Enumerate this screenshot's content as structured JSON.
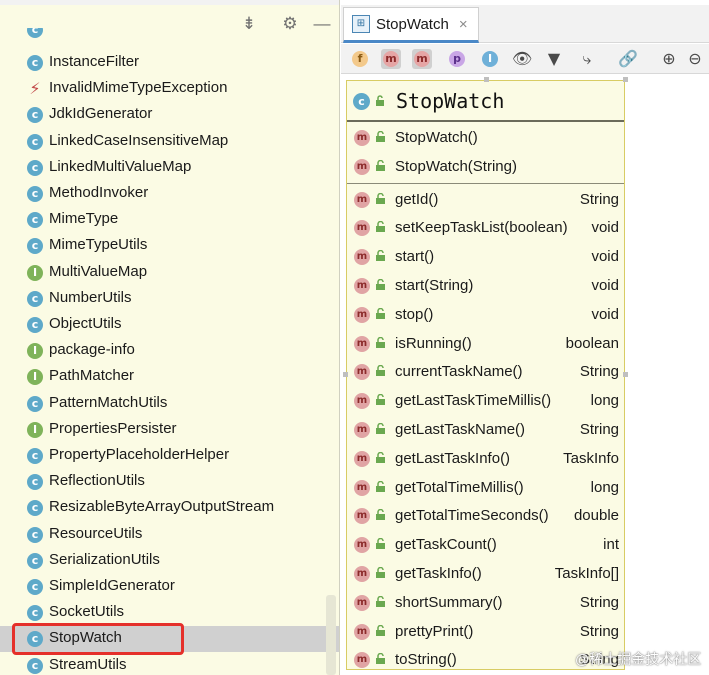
{
  "left_panel": {
    "toolbar": [
      {
        "name": "collapse-icon",
        "glyph": "⇟"
      },
      {
        "name": "gear-icon",
        "glyph": "⚙"
      },
      {
        "name": "minimize-icon",
        "glyph": "—"
      }
    ],
    "items": [
      {
        "label": "InstanceFilter",
        "kind": "class"
      },
      {
        "label": "InvalidMimeTypeException",
        "kind": "exception"
      },
      {
        "label": "JdkIdGenerator",
        "kind": "class"
      },
      {
        "label": "LinkedCaseInsensitiveMap",
        "kind": "class"
      },
      {
        "label": "LinkedMultiValueMap",
        "kind": "class"
      },
      {
        "label": "MethodInvoker",
        "kind": "class"
      },
      {
        "label": "MimeType",
        "kind": "class"
      },
      {
        "label": "MimeTypeUtils",
        "kind": "class"
      },
      {
        "label": "MultiValueMap",
        "kind": "interface"
      },
      {
        "label": "NumberUtils",
        "kind": "class"
      },
      {
        "label": "ObjectUtils",
        "kind": "class"
      },
      {
        "label": "package-info",
        "kind": "interface"
      },
      {
        "label": "PathMatcher",
        "kind": "interface"
      },
      {
        "label": "PatternMatchUtils",
        "kind": "class"
      },
      {
        "label": "PropertiesPersister",
        "kind": "interface"
      },
      {
        "label": "PropertyPlaceholderHelper",
        "kind": "class"
      },
      {
        "label": "ReflectionUtils",
        "kind": "class"
      },
      {
        "label": "ResizableByteArrayOutputStream",
        "kind": "class"
      },
      {
        "label": "ResourceUtils",
        "kind": "class"
      },
      {
        "label": "SerializationUtils",
        "kind": "class"
      },
      {
        "label": "SimpleIdGenerator",
        "kind": "class"
      },
      {
        "label": "SocketUtils",
        "kind": "class"
      },
      {
        "label": "StopWatch",
        "kind": "class",
        "selected": true
      },
      {
        "label": "StreamUtils",
        "kind": "class"
      }
    ]
  },
  "editor_tab": {
    "label": "StopWatch",
    "close_glyph": "×"
  },
  "diagram_toolbar": [
    {
      "name": "fields-toggle-icon",
      "glyph": "f",
      "bg": "#f3c98b",
      "fg": "#8a5a14"
    },
    {
      "name": "constructors-toggle-icon",
      "glyph": "m",
      "bg": "#e6a5a5",
      "fg": "#8c2b2b",
      "pressed": true
    },
    {
      "name": "methods-toggle-icon",
      "glyph": "m",
      "bg": "#e6a5a5",
      "fg": "#8c2b2b",
      "pressed": true
    },
    {
      "name": "properties-toggle-icon",
      "glyph": "p",
      "bg": "#c9a6e6",
      "fg": "#5a2e8a"
    },
    {
      "name": "inner-classes-toggle-icon",
      "glyph": "I",
      "bg": "#6fb0d8",
      "fg": "#ffffff"
    },
    {
      "name": "visibility-eye-icon",
      "glyph": "👁"
    },
    {
      "name": "filter-icon",
      "glyph": "▼"
    },
    {
      "name": "edge-routing-icon",
      "glyph": "⤷"
    },
    {
      "name": "link-icon",
      "glyph": "🔗"
    },
    {
      "name": "zoom-in-icon",
      "glyph": "⊕"
    },
    {
      "name": "zoom-out-icon",
      "glyph": "⊖"
    }
  ],
  "uml_class": {
    "name": "StopWatch",
    "constructors": [
      {
        "name": "StopWatch()",
        "type": ""
      },
      {
        "name": "StopWatch(String)",
        "type": ""
      }
    ],
    "methods": [
      {
        "name": "getId()",
        "type": "String"
      },
      {
        "name": "setKeepTaskList(boolean)",
        "type": "void"
      },
      {
        "name": "start()",
        "type": "void"
      },
      {
        "name": "start(String)",
        "type": "void"
      },
      {
        "name": "stop()",
        "type": "void"
      },
      {
        "name": "isRunning()",
        "type": "boolean"
      },
      {
        "name": "currentTaskName()",
        "type": "String"
      },
      {
        "name": "getLastTaskTimeMillis()",
        "type": "long"
      },
      {
        "name": "getLastTaskName()",
        "type": "String"
      },
      {
        "name": "getLastTaskInfo()",
        "type": "TaskInfo"
      },
      {
        "name": "getTotalTimeMillis()",
        "type": "long"
      },
      {
        "name": "getTotalTimeSeconds()",
        "type": "double"
      },
      {
        "name": "getTaskCount()",
        "type": "int"
      },
      {
        "name": "getTaskInfo()",
        "type": "TaskInfo[]"
      },
      {
        "name": "shortSummary()",
        "type": "String"
      },
      {
        "name": "prettyPrint()",
        "type": "String"
      },
      {
        "name": "toString()",
        "type": "String"
      }
    ]
  },
  "watermark": "@稀土掘金技术社区",
  "colors": {
    "tree_bg": "#fbfbe4",
    "class_icon": "#5ea9c9",
    "interface_icon": "#7fb35a",
    "method_icon": "#e0a4a4",
    "selection_outline": "#e5302a",
    "tab_underline": "#4a88c7"
  }
}
